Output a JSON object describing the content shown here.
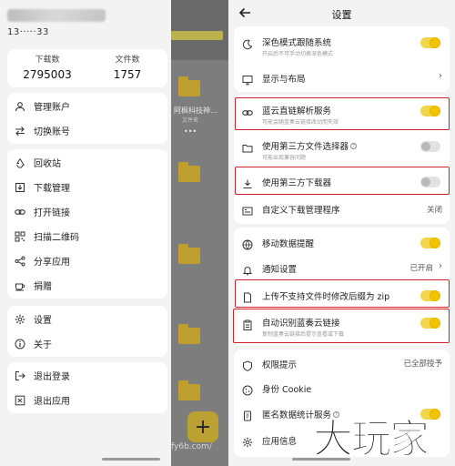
{
  "drawer": {
    "account_blurred": "13164606233",
    "phone_masked": "13·····33",
    "stats": [
      {
        "label": "下载数",
        "value": "2795003"
      },
      {
        "label": "文件数",
        "value": "1757"
      }
    ],
    "group1": [
      {
        "label": "管理账户",
        "icon": "person-icon"
      },
      {
        "label": "切换账号",
        "icon": "switch-arrows-icon"
      }
    ],
    "group2": [
      {
        "label": "回收站",
        "icon": "recycle-icon"
      },
      {
        "label": "下载管理",
        "icon": "download-icon"
      },
      {
        "label": "打开链接",
        "icon": "link-icon"
      },
      {
        "label": "扫描二维码",
        "icon": "qr-code-icon"
      },
      {
        "label": "分享应用",
        "icon": "share-icon"
      },
      {
        "label": "捐赠",
        "icon": "coffee-icon"
      }
    ],
    "group3": [
      {
        "label": "设置",
        "icon": "gear-icon"
      },
      {
        "label": "关于",
        "icon": "info-icon"
      }
    ],
    "group4": [
      {
        "label": "退出登录",
        "icon": "logout-icon"
      },
      {
        "label": "退出应用",
        "icon": "close-box-icon"
      }
    ]
  },
  "background_app": {
    "folder_name": "阿枫科技神…",
    "folder_sub": "文件夹",
    "more": "•••",
    "address": "fy6b.com/",
    "fab_label": "+"
  },
  "settings": {
    "title": "设置",
    "rows": {
      "dark_mode": {
        "title": "深色模式跟随系统"
      },
      "display": {
        "title": "显示与布局"
      },
      "direct_link": {
        "title": "蓝云直链解析服务",
        "subtitle": "可能会随蓝奏云链接改动而失效"
      },
      "file_picker": {
        "title": "使用第三方文件选择器",
        "subtitle": "可能出现兼容问题"
      },
      "downloader": {
        "title": "使用第三方下载器"
      },
      "custom_dl": {
        "title": "自定义下载管理程序",
        "value": "关闭"
      },
      "mobile_data": {
        "title": "移动数据提醒"
      },
      "notify": {
        "title": "通知设置",
        "value": "已开启"
      },
      "upload_zip": {
        "title": "上传不支持文件时修改后缀为 zip"
      },
      "auto_detect": {
        "title": "自动识别蓝奏云链接",
        "subtitle": "复制蓝奏云链接后提示查看或下载"
      },
      "permissions": {
        "title": "权限提示",
        "value": "已全部授予"
      },
      "cookie": {
        "title": "身份 Cookie"
      },
      "stats": {
        "title": "匿名数据统计服务"
      },
      "app_info": {
        "title": "应用信息"
      }
    },
    "dark_mode_subtitle_partial": "开启后不可手动切换深色模式"
  },
  "watermark": "大玩家",
  "colors": {
    "toggle_on": "#f2d54a",
    "highlight": "#d0202a",
    "background": "#f3f3f3"
  }
}
